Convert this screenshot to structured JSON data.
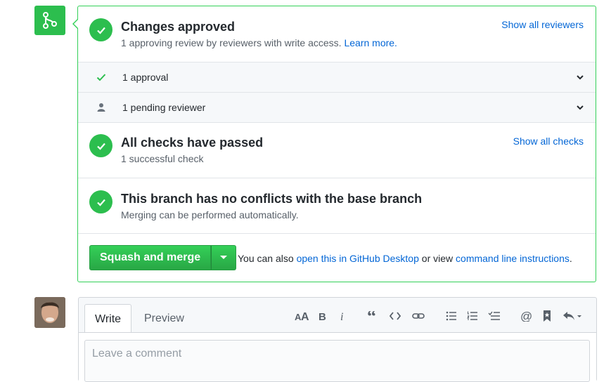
{
  "merge_panel": {
    "approval": {
      "title": "Changes approved",
      "subtitle": "1 approving review by reviewers with write access.",
      "learn_more": "Learn more.",
      "show_all": "Show all reviewers"
    },
    "rows": [
      {
        "label": "1 approval",
        "icon": "check-icon"
      },
      {
        "label": "1 pending reviewer",
        "icon": "person-icon"
      }
    ],
    "checks": {
      "title": "All checks have passed",
      "subtitle": "1 successful check",
      "show_all": "Show all checks"
    },
    "conflicts": {
      "title": "This branch has no conflicts with the base branch",
      "subtitle": "Merging can be performed automatically."
    },
    "merge": {
      "button_label": "Squash and merge",
      "note_prefix": "You can also",
      "desktop_link": "open this in GitHub Desktop",
      "note_middle": "or view",
      "cli_link": "command line instructions",
      "note_suffix": "."
    }
  },
  "comment": {
    "tabs": [
      "Write",
      "Preview"
    ],
    "active_tab": "Write",
    "placeholder": "Leave a comment",
    "toolbar": [
      "text-size-icon",
      "bold-icon",
      "italic-icon",
      "quote-icon",
      "code-icon",
      "link-icon",
      "bullet-list-icon",
      "numbered-list-icon",
      "task-list-icon",
      "mention-icon",
      "bookmark-icon",
      "reply-icon"
    ]
  },
  "colors": {
    "success": "#2cbe4e",
    "border_success": "#34d058",
    "link": "#0366d6"
  }
}
